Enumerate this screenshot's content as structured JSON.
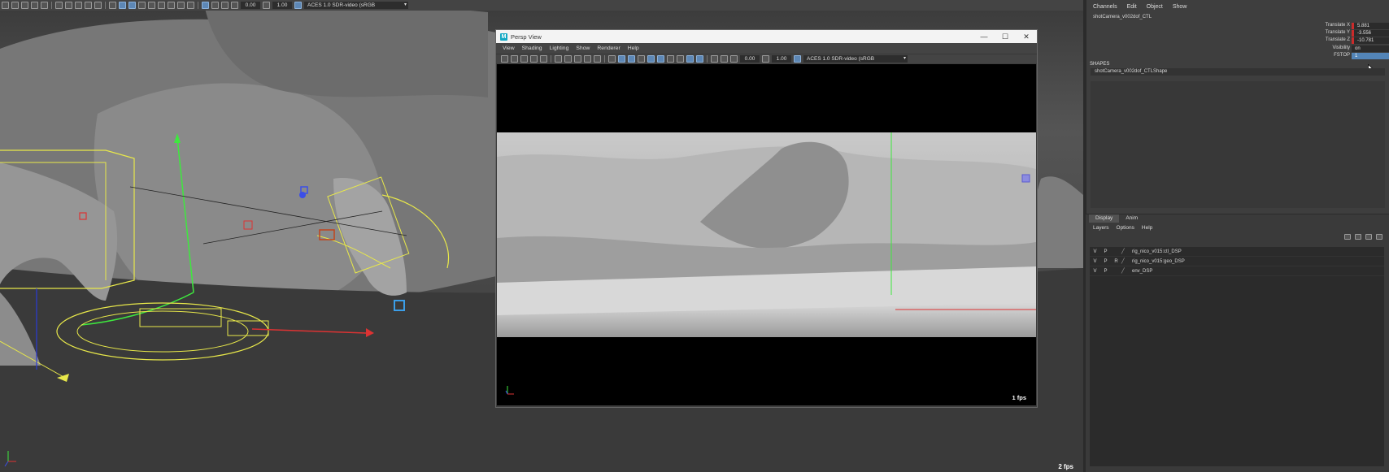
{
  "main_viewport": {
    "toolbar": {
      "field_a": "0.00",
      "field_b": "1.00",
      "color_space": "ACES 1.0 SDR-video (sRGB"
    },
    "fps": "2 fps"
  },
  "persp_window": {
    "title": "Persp View",
    "controls": {
      "minimize": "—",
      "maximize": "☐",
      "close": "✕"
    },
    "menu": [
      "View",
      "Shading",
      "Lighting",
      "Show",
      "Renderer",
      "Help"
    ],
    "toolbar": {
      "field_a": "0.00",
      "field_b": "1.00",
      "color_space": "ACES 1.0 SDR-video (sRGB"
    },
    "fps": "1 fps"
  },
  "channel_box": {
    "menu": [
      "Channels",
      "Edit",
      "Object",
      "Show"
    ],
    "node_name": "shotCamera_v002dof_CTL",
    "attributes": [
      {
        "label": "Translate X",
        "value": "5.881"
      },
      {
        "label": "Translate Y",
        "value": "-3.556"
      },
      {
        "label": "Translate Z",
        "value": "-10.781"
      },
      {
        "label": "Visibility",
        "value": "on"
      },
      {
        "label": "FSTOP",
        "value": "1"
      }
    ],
    "shapes_header": "SHAPES",
    "shape_name": "shotCamera_v002dof_CTLShape"
  },
  "layer_editor": {
    "tabs": [
      "Display",
      "Anim"
    ],
    "menu": [
      "Layers",
      "Options",
      "Help"
    ],
    "layers": [
      {
        "v": "V",
        "p": "P",
        "r": "",
        "name": "rig_nico_v015:ctl_DSP"
      },
      {
        "v": "V",
        "p": "P",
        "r": "R",
        "name": "rig_nico_v015:geo_DSP"
      },
      {
        "v": "V",
        "p": "P",
        "r": "",
        "name": "env_DSP"
      }
    ]
  },
  "colors": {
    "maya_icon": "#11a8c4",
    "selection_blue": "#5385b8",
    "keyed_red": "#cc2a2a",
    "manipulator_yellow": "#e8e84a",
    "manipulator_green": "#3ee83e"
  }
}
